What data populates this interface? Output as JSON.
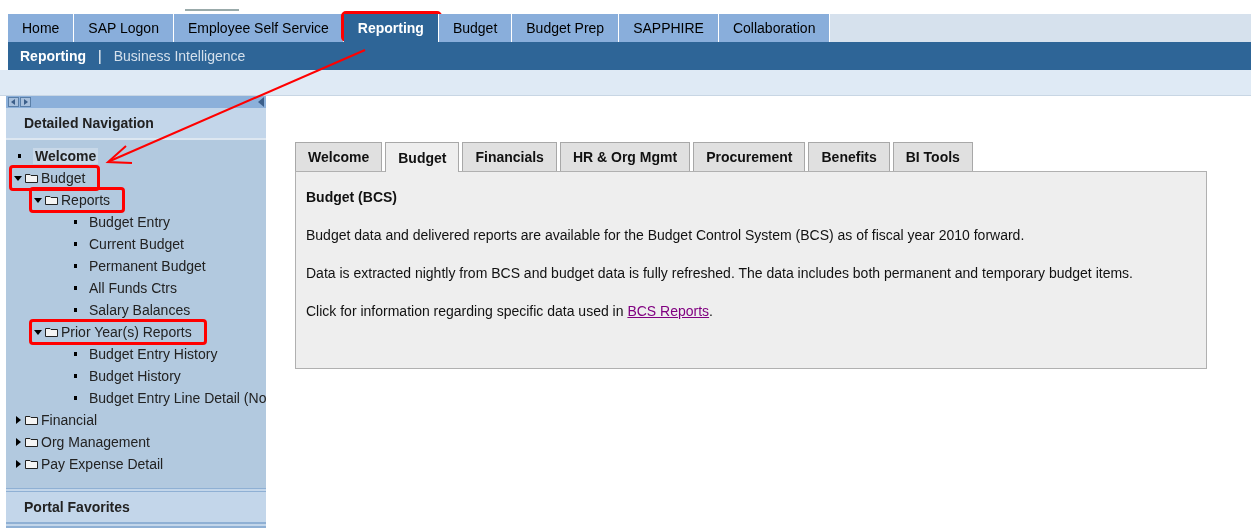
{
  "top_tabs": [
    {
      "label": "Home",
      "selected": false,
      "highlighted": false
    },
    {
      "label": "SAP Logon",
      "selected": false,
      "highlighted": false
    },
    {
      "label": "Employee Self Service",
      "selected": false,
      "highlighted": false
    },
    {
      "label": "Reporting",
      "selected": true,
      "highlighted": true
    },
    {
      "label": "Budget",
      "selected": false,
      "highlighted": false
    },
    {
      "label": "Budget Prep",
      "selected": false,
      "highlighted": false
    },
    {
      "label": "SAPPHIRE",
      "selected": false,
      "highlighted": false
    },
    {
      "label": "Collaboration",
      "selected": false,
      "highlighted": false
    }
  ],
  "sub_nav": {
    "separator": "|",
    "links": [
      {
        "label": "Reporting",
        "selected": true
      },
      {
        "label": "Business Intelligence",
        "selected": false
      }
    ]
  },
  "sidebar": {
    "title": "Detailed Navigation",
    "footer_title": "Portal Favorites",
    "items": [
      {
        "kind": "leaf",
        "label": "Welcome",
        "selected": true,
        "highlighted": false
      },
      {
        "kind": "folder",
        "label": "Budget",
        "expanded": true,
        "highlighted": true,
        "children": [
          {
            "kind": "folder",
            "label": "Reports",
            "expanded": true,
            "highlighted": true,
            "children": [
              {
                "kind": "leaf",
                "label": "Budget Entry",
                "selected": false,
                "highlighted": false
              },
              {
                "kind": "leaf",
                "label": "Current Budget",
                "selected": false,
                "highlighted": false
              },
              {
                "kind": "leaf",
                "label": "Permanent Budget",
                "selected": false,
                "highlighted": false
              },
              {
                "kind": "leaf",
                "label": "All Funds Ctrs",
                "selected": false,
                "highlighted": false
              },
              {
                "kind": "leaf",
                "label": "Salary Balances",
                "selected": false,
                "highlighted": false
              }
            ]
          },
          {
            "kind": "folder",
            "label": "Prior Year(s) Reports",
            "expanded": true,
            "highlighted": true,
            "children": [
              {
                "kind": "leaf",
                "label": "Budget Entry History",
                "selected": false,
                "highlighted": false
              },
              {
                "kind": "leaf",
                "label": "Budget History",
                "selected": false,
                "highlighted": false
              },
              {
                "kind": "leaf",
                "label": "Budget Entry Line Detail (No",
                "selected": false,
                "highlighted": false
              }
            ]
          }
        ]
      },
      {
        "kind": "folder",
        "label": "Financial",
        "expanded": false,
        "highlighted": false
      },
      {
        "kind": "folder",
        "label": "Org Management",
        "expanded": false,
        "highlighted": false
      },
      {
        "kind": "folder",
        "label": "Pay Expense Detail",
        "expanded": false,
        "highlighted": false
      }
    ]
  },
  "content_tabs": [
    {
      "label": "Welcome",
      "selected": false
    },
    {
      "label": "Budget",
      "selected": true
    },
    {
      "label": "Financials",
      "selected": false
    },
    {
      "label": "HR & Org Mgmt",
      "selected": false
    },
    {
      "label": "Procurement",
      "selected": false
    },
    {
      "label": "Benefits",
      "selected": false
    },
    {
      "label": "BI Tools",
      "selected": false
    }
  ],
  "panel": {
    "heading": "Budget (BCS)",
    "paragraphs": [
      "Budget data and delivered reports are available for the Budget Control System (BCS) as of fiscal year 2010 forward.",
      "Data is extracted nightly from BCS and budget data is fully refreshed. The data includes both permanent and temporary budget items."
    ],
    "link_sentence": {
      "before": "Click for information regarding specific data used in",
      "link": "BCS Reports",
      "after": "."
    }
  }
}
